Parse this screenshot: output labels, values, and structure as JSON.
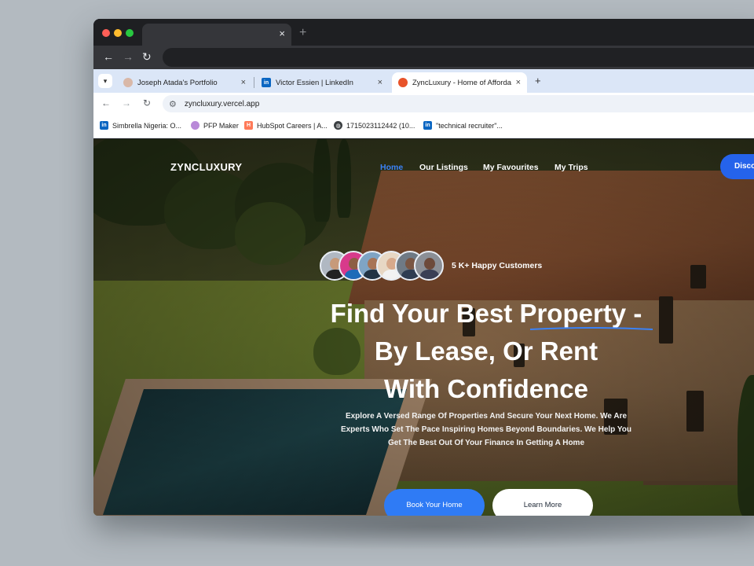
{
  "outer_browser": {
    "tab_close": "×",
    "new_tab": "+"
  },
  "inner_browser": {
    "tabs": [
      {
        "label": "Joseph Atada's Portfolio",
        "active": false
      },
      {
        "label": "Victor Essien | LinkedIn",
        "active": false
      },
      {
        "label": "ZyncLuxury - Home of Afforda",
        "active": true
      }
    ],
    "tab_close": "×",
    "new_tab": "+",
    "url": "zyncluxury.vercel.app",
    "bookmarks": [
      {
        "label": "Simbrella Nigeria: O...",
        "icon": "linkedin-icon"
      },
      {
        "label": "PFP Maker",
        "icon": "pfp-icon"
      },
      {
        "label": "HubSpot Careers | A...",
        "icon": "hubspot-icon"
      },
      {
        "label": "1715023112442 (10...",
        "icon": "globe-icon"
      },
      {
        "label": "\"technical recruiter\"...",
        "icon": "linkedin-icon"
      }
    ]
  },
  "site": {
    "logo": "ZYNCLUXURY",
    "nav": [
      {
        "label": "Home",
        "active": true
      },
      {
        "label": "Our Listings",
        "active": false
      },
      {
        "label": "My Favourites",
        "active": false
      },
      {
        "label": "My Trips",
        "active": false
      }
    ],
    "cta_label": "Disco",
    "happy_customers": "5 K+ Happy Customers",
    "headline_lines": [
      "Find Your Best Property -",
      "By Lease, Or Rent",
      "With Confidence"
    ],
    "subtext_lines": [
      "Explore A Versed Range Of Properties And Secure Your Next Home. We Are",
      "Experts Who Set The Pace Inspiring Homes Beyond Boundaries. We Help You",
      "Get The Best Out Of Your Finance In Getting A Home"
    ],
    "primary_button": "Book Your Home",
    "secondary_button": "Learn More"
  },
  "colors": {
    "accent": "#2f7bf5",
    "nav_active": "#3b82f6",
    "backdrop": "#b3bac0"
  }
}
